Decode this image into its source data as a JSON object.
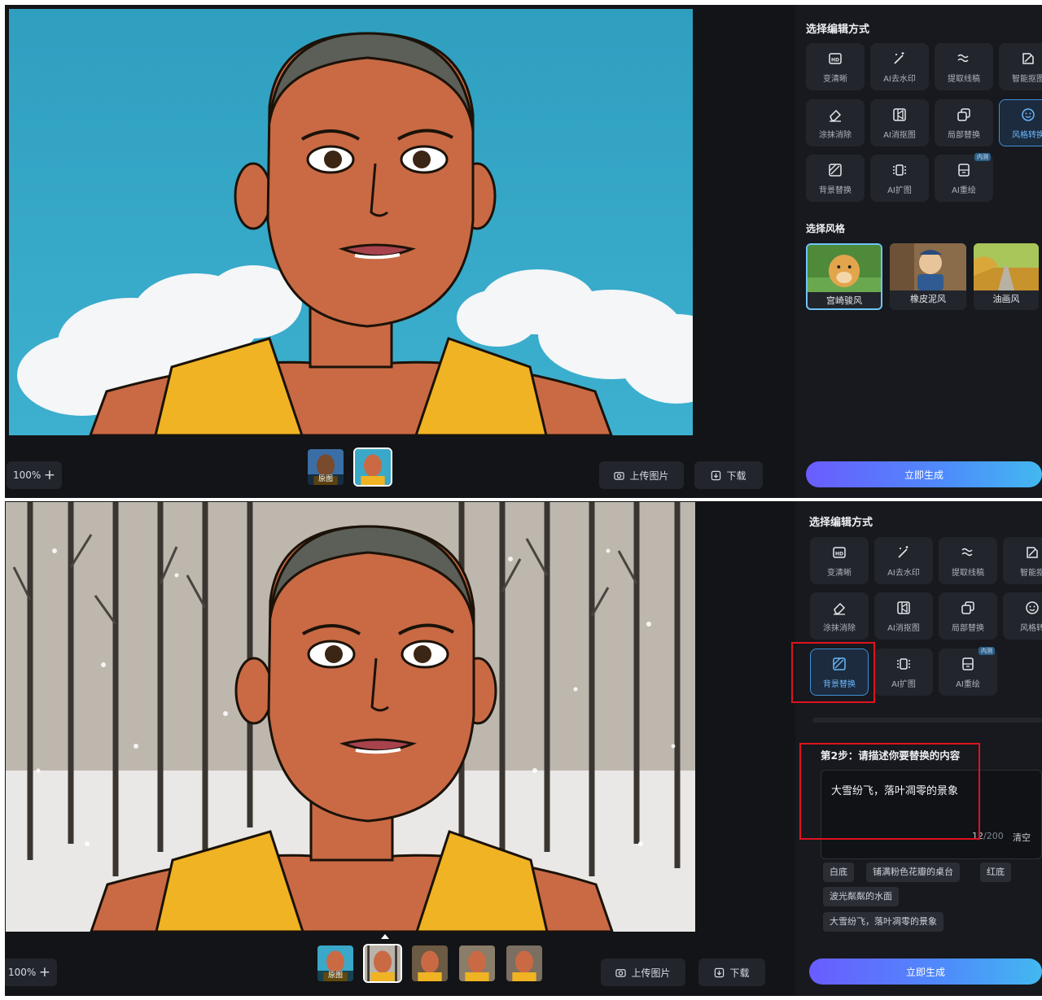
{
  "colors": {
    "accent": "#3f8fd6",
    "highlight": "#e0121e",
    "panel_bg": "#14161b"
  },
  "panel_top": {
    "zoom": {
      "value": "100%",
      "plus": "+"
    },
    "thumbs": [
      {
        "tag": "原图",
        "icon": "original-portrait-thumb"
      },
      {
        "tag": "",
        "icon": "ghibli-result-thumb"
      }
    ],
    "upload_label": "上传图片",
    "download_label": "下载",
    "section_title": "选择编辑方式",
    "tools": [
      {
        "label": "变清晰",
        "icon": "hd-icon"
      },
      {
        "label": "AI去水印",
        "icon": "magic-wand-icon"
      },
      {
        "label": "提取线稿",
        "icon": "line-extract-icon"
      },
      {
        "label": "智能抠图",
        "icon": "smart-cutout-icon"
      },
      {
        "label": "涂抹消除",
        "icon": "eraser-icon"
      },
      {
        "label": "AI消抠图",
        "icon": "ai-cutout-icon"
      },
      {
        "label": "局部替换",
        "icon": "partial-replace-icon"
      },
      {
        "label": "风格转换",
        "icon": "style-transfer-icon"
      },
      {
        "label": "背景替换",
        "icon": "background-replace-icon"
      },
      {
        "label": "AI扩图",
        "icon": "expand-icon"
      },
      {
        "label": "AI重绘",
        "icon": "redraw-icon",
        "badge": "内测"
      }
    ],
    "style_title": "选择风格",
    "styles": [
      {
        "label": "宫崎骏风"
      },
      {
        "label": "橡皮泥风"
      },
      {
        "label": "油画风"
      }
    ],
    "generate_label": "立即生成"
  },
  "panel_bottom": {
    "zoom": {
      "value": "100%",
      "plus": "+"
    },
    "thumbs": [
      {
        "tag": "原图",
        "icon": "original-portrait-thumb"
      },
      {
        "tag": "",
        "icon": "snow-result-thumb"
      },
      {
        "tag": "",
        "icon": "variant-thumb"
      },
      {
        "tag": "",
        "icon": "variant-thumb"
      },
      {
        "tag": "",
        "icon": "variant-thumb"
      }
    ],
    "upload_label": "上传图片",
    "download_label": "下载",
    "section_title": "选择编辑方式",
    "tools": [
      {
        "label": "变清晰",
        "icon": "hd-icon"
      },
      {
        "label": "AI去水印",
        "icon": "magic-wand-icon"
      },
      {
        "label": "提取线稿",
        "icon": "line-extract-icon"
      },
      {
        "label": "智能抠",
        "icon": "smart-cutout-icon"
      },
      {
        "label": "涂抹消除",
        "icon": "eraser-icon"
      },
      {
        "label": "AI消抠图",
        "icon": "ai-cutout-icon"
      },
      {
        "label": "局部替换",
        "icon": "partial-replace-icon"
      },
      {
        "label": "风格转",
        "icon": "style-transfer-icon"
      },
      {
        "label": "背景替换",
        "icon": "background-replace-icon"
      },
      {
        "label": "AI扩图",
        "icon": "expand-icon"
      },
      {
        "label": "AI重绘",
        "icon": "redraw-icon",
        "badge": "内测"
      }
    ],
    "step2_title": "第2步：请描述你要替换的内容",
    "prompt_value": "大雪纷飞，落叶凋零的景象",
    "counter_current": "12",
    "counter_max": "/200",
    "clear_label": "清空",
    "presets": [
      "白底",
      "铺满粉色花瓣的桌台",
      "红底",
      "波光粼粼的水面",
      "大雪纷飞，落叶凋零的景象"
    ],
    "generate_label": "立即生成"
  }
}
